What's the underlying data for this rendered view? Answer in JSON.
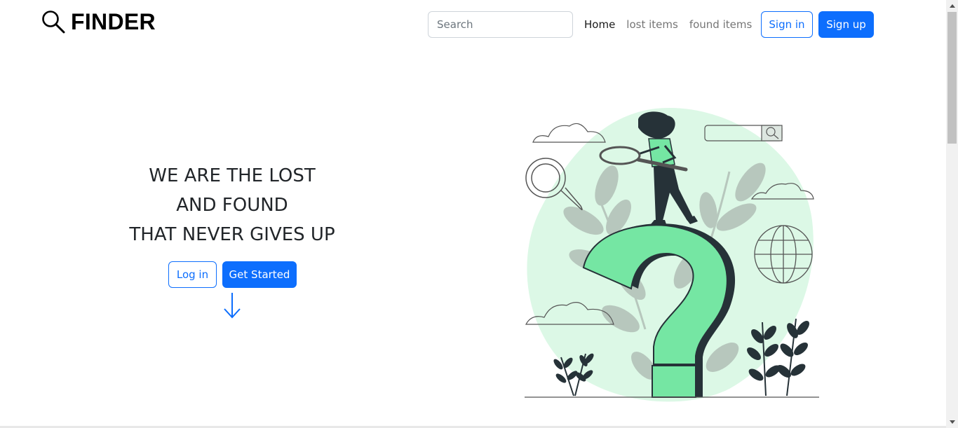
{
  "navbar": {
    "brand": "FINDER",
    "search_placeholder": "Search",
    "links": [
      {
        "label": "Home"
      },
      {
        "label": "lost items"
      },
      {
        "label": "found items"
      }
    ],
    "signin_label": "Sign in",
    "signup_label": "Sign up"
  },
  "hero": {
    "title_lines": [
      "WE ARE THE LOST",
      "AND FOUND",
      "THAT NEVER GIVES UP"
    ],
    "login_label": "Log in",
    "get_started_label": "Get Started"
  },
  "colors": {
    "primary": "#0d6efd",
    "illustration_green": "#75e6a3",
    "illustration_bg": "#dcf8e6",
    "leaf": "#b7c7bd",
    "dark": "#263238"
  },
  "icons": {
    "brand": "magnifier-icon",
    "scroll_down": "arrow-down-icon",
    "illustration": "lost-and-found-illustration"
  }
}
